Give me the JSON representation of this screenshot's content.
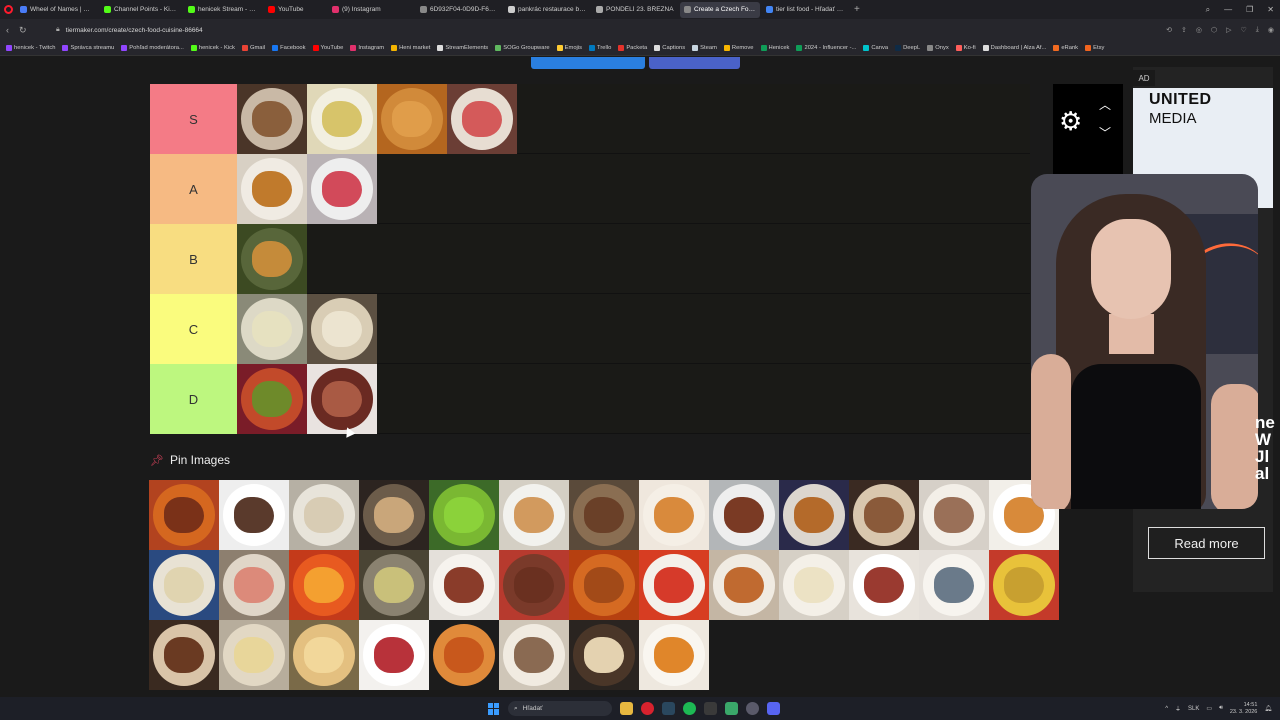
{
  "browser": {
    "tabs": [
      {
        "title": "Wheel of Names | Rando",
        "color": "#4a7cf7"
      },
      {
        "title": "Channel Points - Kick Das",
        "color": "#53fc18"
      },
      {
        "title": "henicek Stream - Watch L",
        "color": "#53fc18"
      },
      {
        "title": "YouTube",
        "color": "#ff0000"
      },
      {
        "title": "(9) Instagram",
        "color": "#e1306c"
      },
      {
        "title": "6D932F04-0D9D-F686-2(",
        "color": "#888888"
      },
      {
        "title": "pankrác restaurace brambo",
        "color": "#cccccc"
      },
      {
        "title": "PONDĚLÍ 23. BŘEZNA",
        "color": "#aaaaaa"
      },
      {
        "title": "Create a Czech Food/Cu",
        "color": "#888888",
        "active": true
      },
      {
        "title": "tier list food - Hľadať Go",
        "color": "#4285f4"
      }
    ],
    "url": "tiermaker.com/create/czech-food-cuisine-86664",
    "bookmarks": [
      {
        "label": "henicek - Twitch",
        "color": "#9146ff"
      },
      {
        "label": "Správca streamu",
        "color": "#9146ff"
      },
      {
        "label": "Pohľad moderátora...",
        "color": "#9146ff"
      },
      {
        "label": "henicek - Kick",
        "color": "#53fc18"
      },
      {
        "label": "Gmail",
        "color": "#ea4335"
      },
      {
        "label": "Facebook",
        "color": "#1877f2"
      },
      {
        "label": "YouTube",
        "color": "#ff0000"
      },
      {
        "label": "Instagram",
        "color": "#e1306c"
      },
      {
        "label": "Heni market",
        "color": "#f4b400"
      },
      {
        "label": "StreamElements",
        "color": "#dddddd"
      },
      {
        "label": "SOGo Groupware",
        "color": "#5fb85f"
      },
      {
        "label": "Emojis",
        "color": "#ffcc33"
      },
      {
        "label": "Trello",
        "color": "#0079bf"
      },
      {
        "label": "Packeta",
        "color": "#e4322b"
      },
      {
        "label": "Captions",
        "color": "#dddddd"
      },
      {
        "label": "Steam",
        "color": "#c7d5e0"
      },
      {
        "label": "Remove",
        "color": "#f7b500"
      },
      {
        "label": "Henicek",
        "color": "#0f9d58"
      },
      {
        "label": "2024 - Influencer -...",
        "color": "#0f9d58"
      },
      {
        "label": "Canva",
        "color": "#00c4cc"
      },
      {
        "label": "DeepL",
        "color": "#0f2b46"
      },
      {
        "label": "Onyx",
        "color": "#888888"
      },
      {
        "label": "Ko-fi",
        "color": "#ff5e5b"
      },
      {
        "label": "Dashboard | Alza Af...",
        "color": "#dddddd"
      },
      {
        "label": "eRank",
        "color": "#f26b21"
      },
      {
        "label": "Etsy",
        "color": "#f1641e"
      }
    ]
  },
  "tiers": [
    {
      "label": "S",
      "color": "#f47b86",
      "items": [
        {
          "bg": "#4a3528",
          "plate": "#c9b9a6",
          "food": "#8a5f3c"
        },
        {
          "bg": "#e0d8b8",
          "plate": "#f2efe1",
          "food": "#d7c46a"
        },
        {
          "bg": "#b4661f",
          "plate": "#d18a3a",
          "food": "#e09d4a"
        },
        {
          "bg": "#6b3e35",
          "plate": "#e7ddd2",
          "food": "#d45a5a"
        }
      ]
    },
    {
      "label": "A",
      "color": "#f6ba83",
      "items": [
        {
          "bg": "#d8d0c4",
          "plate": "#f0ebe3",
          "food": "#c07a2c"
        },
        {
          "bg": "#b9b2b5",
          "plate": "#eeeeee",
          "food": "#d24a5a"
        }
      ]
    },
    {
      "label": "B",
      "color": "#f8dd81",
      "items": [
        {
          "bg": "#3c4a22",
          "plate": "#58663a",
          "food": "#c58b3a"
        }
      ]
    },
    {
      "label": "C",
      "color": "#fafc7e",
      "items": [
        {
          "bg": "#8a8a78",
          "plate": "#ddd9c6",
          "food": "#e6e1c0"
        },
        {
          "bg": "#5c5042",
          "plate": "#d9cdb5",
          "food": "#ece4d0"
        }
      ]
    },
    {
      "label": "D",
      "color": "#bdf77f",
      "items": [
        {
          "bg": "#7a1c28",
          "plate": "#c24a2a",
          "food": "#6e8a2a"
        },
        {
          "bg": "#e9e3e0",
          "plate": "#6a2a22",
          "food": "#a95a44"
        }
      ]
    }
  ],
  "pin_images": {
    "title": "Pin Images",
    "items": [
      {
        "bg": "#b2431f",
        "plate": "#d5671f",
        "food": "#7a3118"
      },
      {
        "bg": "#eeeeee",
        "plate": "#ffffff",
        "food": "#5a3a2c"
      },
      {
        "bg": "#b6b0a4",
        "plate": "#e8e4da",
        "food": "#d8ccb4"
      },
      {
        "bg": "#2c2420",
        "plate": "#6c5c4a",
        "food": "#c9a67a"
      },
      {
        "bg": "#3c6a28",
        "plate": "#7ab832",
        "food": "#8bd23a"
      },
      {
        "bg": "#d4cfc4",
        "plate": "#f2f2ee",
        "food": "#d29a5e"
      },
      {
        "bg": "#5a4a3a",
        "plate": "#8a6e52",
        "food": "#6a4028"
      },
      {
        "bg": "#efe7dd",
        "plate": "#f5efe6",
        "food": "#d98a3c"
      },
      {
        "bg": "#b3b6b8",
        "plate": "#eeeeee",
        "food": "#7a3a24"
      },
      {
        "bg": "#2a2a4a",
        "plate": "#dcd6ce",
        "food": "#b46a2a"
      },
      {
        "bg": "#3a2a22",
        "plate": "#d9c7ae",
        "food": "#8a5a3a"
      },
      {
        "bg": "#d6d0c8",
        "plate": "#f3efe8",
        "food": "#9a7058"
      },
      {
        "bg": "#f2efe9",
        "plate": "#ffffff",
        "food": "#d88a3a"
      },
      {
        "bg": "#2a4a80",
        "plate": "#e8e2d4",
        "food": "#e0d4b0"
      },
      {
        "bg": "#8d7f6f",
        "plate": "#e0d6c8",
        "food": "#dc8a7a"
      },
      {
        "bg": "#c43a1a",
        "plate": "#e85a20",
        "food": "#f4a030"
      },
      {
        "bg": "#4a4434",
        "plate": "#8a8270",
        "food": "#c9c07a"
      },
      {
        "bg": "#e4e0da",
        "plate": "#f6f3ee",
        "food": "#8a3c2a"
      },
      {
        "bg": "#b73a2e",
        "plate": "#7a3a2a",
        "food": "#6a3020"
      },
      {
        "bg": "#b64010",
        "plate": "#d56a22",
        "food": "#a24a18"
      },
      {
        "bg": "#d73d22",
        "plate": "#f4f0ea",
        "food": "#d63a2a"
      },
      {
        "bg": "#c4b6a4",
        "plate": "#f0ebe2",
        "food": "#c06a30"
      },
      {
        "bg": "#d6d0c6",
        "plate": "#f4f0e8",
        "food": "#ece2c4"
      },
      {
        "bg": "#e8e3dc",
        "plate": "#ffffff",
        "food": "#9a3a30"
      },
      {
        "bg": "#e5e0da",
        "plate": "#f7f4ef",
        "food": "#6a7a8a"
      },
      {
        "bg": "#c43a2a",
        "plate": "#e8c23a",
        "food": "#c8a030"
      },
      {
        "bg": "#3a2a20",
        "plate": "#d9c4a8",
        "food": "#6a3a22"
      },
      {
        "bg": "#b7ad9c",
        "plate": "#e2d8c4",
        "food": "#e8d69a"
      },
      {
        "bg": "#7a6a48",
        "plate": "#e4c080",
        "food": "#f2d79a"
      },
      {
        "bg": "#f3f1ee",
        "plate": "#ffffff",
        "food": "#b8323a"
      },
      {
        "bg": "#1c1c1c",
        "plate": "#e08a3a",
        "food": "#c8581c"
      },
      {
        "bg": "#cfc6b8",
        "plate": "#f1ebe1",
        "food": "#8a6a52"
      },
      {
        "bg": "#2a2420",
        "plate": "#4a3628",
        "food": "#e4d2b0"
      },
      {
        "bg": "#eee8df",
        "plate": "#f9f6f0",
        "food": "#e0862a"
      }
    ]
  },
  "ad": {
    "label": "AD",
    "brand_line1": "UNITED",
    "brand_line2": "MEDIA",
    "cta": "Read more",
    "side_text": "ne W Jl al"
  },
  "taskbar": {
    "search_placeholder": "Hľadať",
    "lang": "SLK",
    "time": "14:51",
    "date": "23. 3. 2026"
  }
}
